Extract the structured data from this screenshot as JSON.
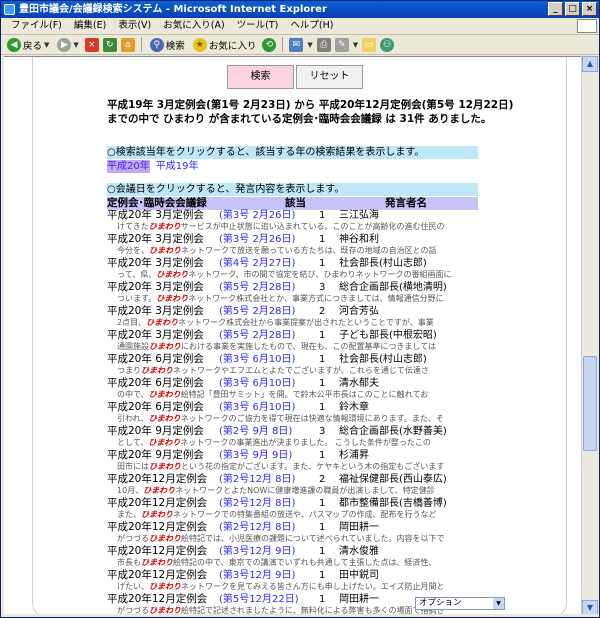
{
  "window": {
    "title": "豊田市議会/会議録検索システム - Microsoft Internet Explorer"
  },
  "menu": [
    "ファイル(F)",
    "編集(E)",
    "表示(V)",
    "お気に入り(A)",
    "ツール(T)",
    "ヘルプ(H)"
  ],
  "toolbar": {
    "back": "戻る",
    "search": "検索",
    "favorites": "お気に入り"
  },
  "buttons": {
    "search": "検索",
    "reset": "リセット"
  },
  "summary": "平成19年 3月定例会(第1号 2月23日) から 平成20年12月定例会(第5号 12月22日)までの中で ひまわり が含まれている定例会･臨時会会議録 は 31件 ありました。",
  "info_year": "○検索該当年をクリックすると、該当する年の検索結果を表示します。",
  "years": {
    "selected": "平成20年",
    "other": "平成19年"
  },
  "info_date": "○会議日をクリックすると、発言内容を表示します。",
  "table": {
    "headers": {
      "meeting": "定例会･臨時会会議録",
      "applicable": "該当",
      "speaker": "発言者名"
    },
    "rows": [
      {
        "meeting": "平成20年 3月定例会",
        "date": "(第3号 2月26日)",
        "count": "1",
        "speaker": "三江弘海",
        "pre": "けてきた",
        "hl": "ひまわり",
        "post": "サービスが中止状態に追い込まれている。このことが高齢化の進む住民の"
      },
      {
        "meeting": "平成20年 3月定例会",
        "date": "(第3号 2月26日)",
        "count": "1",
        "speaker": "神谷和利",
        "pre": "今分を、",
        "hl": "ひまわり",
        "post": "ネットワークで放送を願っている方たちは、既存の地域の自治区との話"
      },
      {
        "meeting": "平成20年 3月定例会",
        "date": "(第4号 2月27日)",
        "count": "1",
        "speaker": "社会部長(村山志郎)",
        "pre": "って、県、",
        "hl": "ひまわり",
        "post": "ネットワーク、市の間で協定を結び、ひまわりネットワークの番組画面に"
      },
      {
        "meeting": "平成20年 3月定例会",
        "date": "(第5号 2月28日)",
        "count": "3",
        "speaker": "総合企画部長(横地清明)",
        "pre": "ついます。",
        "hl": "ひまわり",
        "post": "ネットワーク株式会社とか、事業方式につきましては、情報通信分野に"
      },
      {
        "meeting": "平成20年 3月定例会",
        "date": "(第5号 2月28日)",
        "count": "2",
        "speaker": "河合芳弘",
        "pre": "2点目、",
        "hl": "ひまわり",
        "post": "ネットワーク株式会社から事業提案が出されたということですが、事業"
      },
      {
        "meeting": "平成20年 3月定例会",
        "date": "(第5号 2月28日)",
        "count": "1",
        "speaker": "子ども部長(中根宏昭)",
        "pre": "通園施設",
        "hl": "ひまわり",
        "post": "における事業を実施したもので、現在も、この配置基準につきましては"
      },
      {
        "meeting": "平成20年 6月定例会",
        "date": "(第3号 6月10日)",
        "count": "1",
        "speaker": "社会部長(村山志郎)",
        "pre": "つまり",
        "hl": "ひまわり",
        "post": "ネットワークやエフエムとよたでございますが、これらを通じて伝達さ"
      },
      {
        "meeting": "平成20年 6月定例会",
        "date": "(第3号 6月10日)",
        "count": "1",
        "speaker": "清水郁夫",
        "pre": "の中で、",
        "hl": "ひまわり",
        "post": "絵特記「豊田サミット」を開。で鈴木公平市長はこのことに触れてお"
      },
      {
        "meeting": "平成20年 6月定例会",
        "date": "(第3号 6月10日)",
        "count": "1",
        "speaker": "鈴木章",
        "pre": "引われ、",
        "hl": "ひまわり",
        "post": "ネットワークのご協力を得て現在は快適な情報環境にあります。また、そ"
      },
      {
        "meeting": "平成20年 9月定例会",
        "date": "(第2号 9月 8日)",
        "count": "3",
        "speaker": "総合企画部長(水野善美)",
        "pre": "として、",
        "hl": "ひまわり",
        "post": "ネットワークの事業進出が決まりました。 こうした条件が整ったこの"
      },
      {
        "meeting": "平成20年 9月定例会",
        "date": "(第3号 9月 9日)",
        "count": "1",
        "speaker": "杉浦昇",
        "pre": "田市には",
        "hl": "ひまわり",
        "post": "という花の指定がございます。また、ケヤキという木の指定もございます"
      },
      {
        "meeting": "平成20年12月定例会",
        "date": "(第2号12月 8日)",
        "count": "2",
        "speaker": "福祉保健部長(西山泰広)",
        "pre": "10月、",
        "hl": "ひまわり",
        "post": "ネットワークとよたNOWに健康増進課の職員が出演しまして、特定健診"
      },
      {
        "meeting": "平成20年12月定例会",
        "date": "(第2号12月 8日)",
        "count": "1",
        "speaker": "都市整備部長(吉橋善博)",
        "pre": "また、",
        "hl": "ひまわり",
        "post": "ネットワークでの特集番組の放送や、パスマップの作成、配布を行うなど"
      },
      {
        "meeting": "平成20年12月定例会",
        "date": "(第2号12月 8日)",
        "count": "1",
        "speaker": "岡田耕一",
        "pre": "がつづる",
        "hl": "ひまわり",
        "post": "絵特記では、小児医療の課題について述べられていました。内容を以下で"
      },
      {
        "meeting": "平成20年12月定例会",
        "date": "(第3号12月 9日)",
        "count": "1",
        "speaker": "清水俊雅",
        "pre": "市長も",
        "hl": "ひまわり",
        "post": "絵特記の中で、東京での講演でいずれも共通して主張した点は、経済性、"
      },
      {
        "meeting": "平成20年12月定例会",
        "date": "(第3号12月 9日)",
        "count": "1",
        "speaker": "田中鋭司",
        "pre": "げたい、",
        "hl": "ひまわり",
        "post": "ネットワークを見てみえる皆さん方にも申し上げたい。エイズ防止月間と"
      },
      {
        "meeting": "平成20年12月定例会",
        "date": "(第5号12月22日)",
        "count": "1",
        "speaker": "岡田耕一",
        "pre": "がつづる",
        "hl": "ひまわり",
        "post": "絵特記で記述されましたように、無料化による弊害も多くの場面で指摘さ"
      }
    ]
  },
  "option_select": "オプション"
}
